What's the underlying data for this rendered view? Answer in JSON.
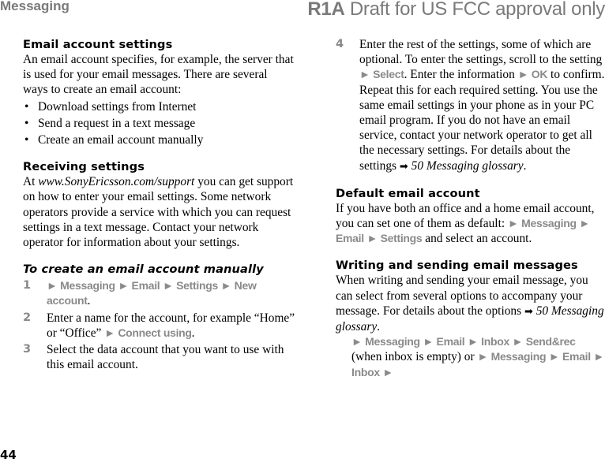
{
  "header": {
    "section": "Messaging",
    "draft_bold": "R1A",
    "draft_text": " Draft for US FCC approval only"
  },
  "email_account_settings": {
    "title": "Email account settings",
    "body": "An email account specifies, for example, the server that is used for your email messages. There are several ways to create an email account:",
    "bullets": [
      "Download settings from Internet",
      "Send a request in a text message",
      "Create an email account manually"
    ],
    "bullet_glyph": "•"
  },
  "receiving_settings": {
    "title": "Receiving settings",
    "url": "www.SonyEricsson.com/support",
    "body_start": "At ",
    "body_rest": " you can get support on how to enter your email settings. Some network operators provide a service with which you can request settings in a text message. Contact your network operator for information about your settings."
  },
  "create_manually": {
    "title": "To create an email account manually",
    "steps": [
      {
        "num": "1",
        "nav": "► Messaging ► Email ► Settings ► New account",
        "tail": "."
      },
      {
        "num": "2",
        "text": "Enter a name for the account, for example “Home” or “Office” ",
        "nav": "► Connect using",
        "tail": "."
      },
      {
        "num": "3",
        "text": "Select the data account that you want to use with this email account."
      },
      {
        "num": "4",
        "text1": "Enter the rest of the settings, some of which are optional. To enter the settings, scroll to the setting ",
        "nav1": "► Select",
        "text2": ". Enter the information ",
        "nav2": "► OK",
        "text3": " to confirm. Repeat this for each required setting. You use the same email settings in your phone as in your PC email program. If you do not have an email service, contact your network operator to get all the necessary settings. For details about the settings ",
        "ref_arrow": "➡",
        "ref": " 50 Messaging glossary",
        "tail": "."
      }
    ]
  },
  "default_account": {
    "title": "Default email account",
    "body": "If you have both an office and a home email account, you can set one of them as default: ",
    "nav": "► Messaging ► Email ► Settings",
    "tail": " and select an account."
  },
  "writing_sending": {
    "title": "Writing and sending email messages",
    "body": "When writing and sending your email message, you can select from several options to accompany your message. For details about the options ",
    "ref_arrow": "➡",
    "ref": " 50 Messaging glossary",
    "tail": ".",
    "nav1": "► Messaging ► Email ► Inbox ► Send&rec",
    "mid": " (when inbox is empty) or ",
    "nav2": "► Messaging ► Email ► Inbox ►"
  },
  "footer": {
    "page_number": "44"
  }
}
